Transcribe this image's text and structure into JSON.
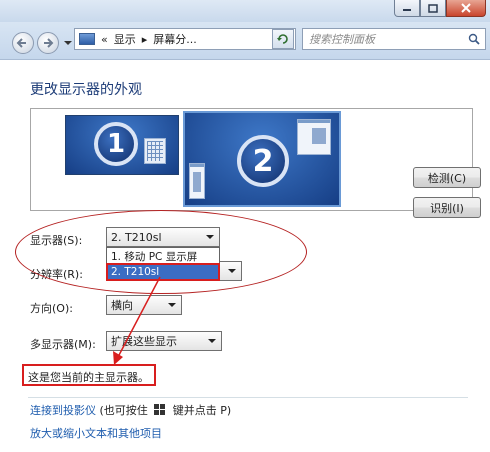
{
  "navigation": {
    "breadcrumb_prefix": "«",
    "breadcrumb_item_1": "显示",
    "breadcrumb_sep": "▸",
    "breadcrumb_item_2": "屏幕分..."
  },
  "search": {
    "placeholder": "搜索控制面板"
  },
  "page": {
    "title": "更改显示器的外观"
  },
  "preview": {
    "monitor_1": "1",
    "monitor_2": "2"
  },
  "buttons": {
    "detect": "检测(C)",
    "identify": "识别(I)"
  },
  "settings": {
    "display_label": "显示器(S):",
    "display_value": "2. T210sl",
    "display_options": [
      "1. 移动 PC 显示屏",
      "2. T210sl"
    ],
    "resolution_label": "分辨率(R):",
    "orientation_label": "方向(O):",
    "orientation_value": "横向",
    "multi_display_label": "多显示器(M):",
    "multi_display_value": "扩展这些显示"
  },
  "status": {
    "main_display_text": "这是您当前的主显示器。"
  },
  "links": {
    "projector_link": "连接到投影仪",
    "projector_hint_pre": "(也可按住",
    "projector_hint_post": "键并点击 P)",
    "text_size_link": "放大或缩小文本和其他项目"
  },
  "colors": {
    "annotation": "#d81e1e",
    "link": "#1f5dae",
    "title": "#1e3d78",
    "selection": "#3b6dc3"
  }
}
